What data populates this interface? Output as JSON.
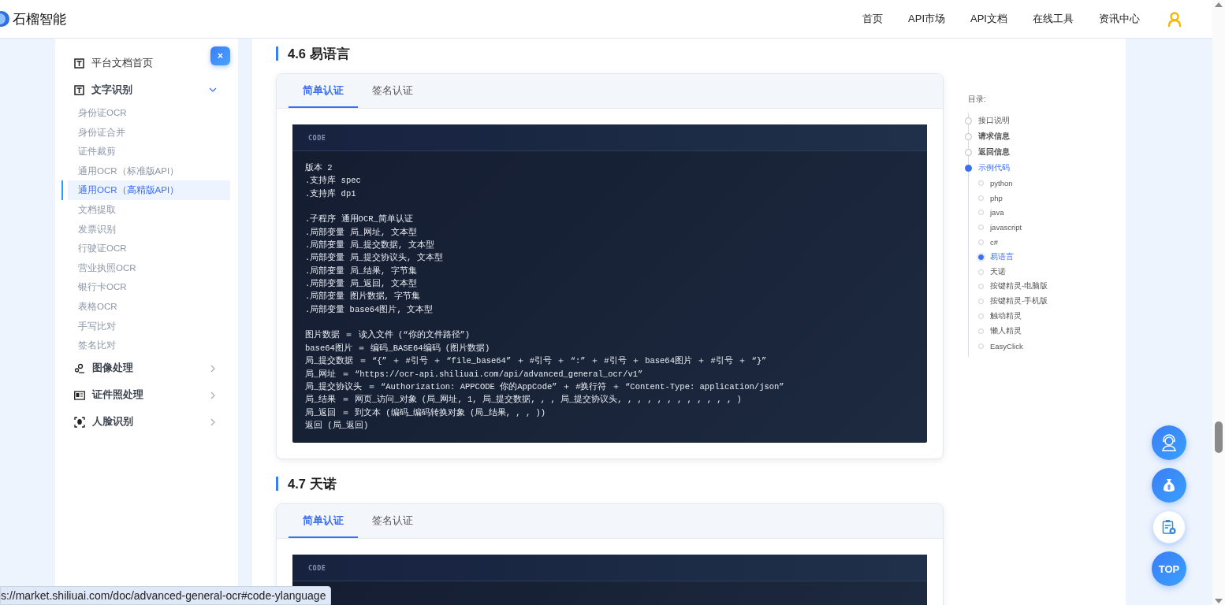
{
  "header": {
    "brand": "石榴智能",
    "nav": [
      {
        "label": "首页"
      },
      {
        "label": "API市场"
      },
      {
        "label": "API文档"
      },
      {
        "label": "在线工具"
      },
      {
        "label": "资讯中心"
      }
    ]
  },
  "sidebar": {
    "close": "×",
    "items": [
      {
        "label": "平台文档首页",
        "kind": "text"
      },
      {
        "label": "文字识别",
        "kind": "text",
        "expanded": true,
        "children": [
          {
            "label": "身份证OCR",
            "selected": false
          },
          {
            "label": "身份证合并",
            "selected": false
          },
          {
            "label": "证件裁剪",
            "selected": false
          },
          {
            "label": "通用OCR（标准版API）",
            "selected": false
          },
          {
            "label": "通用OCR（高精版API）",
            "selected": true
          },
          {
            "label": "文档提取",
            "selected": false
          },
          {
            "label": "发票识别",
            "selected": false
          },
          {
            "label": "行驶证OCR",
            "selected": false
          },
          {
            "label": "营业执照OCR",
            "selected": false
          },
          {
            "label": "银行卡OCR",
            "selected": false
          },
          {
            "label": "表格OCR",
            "selected": false
          },
          {
            "label": "手写比对",
            "selected": false
          },
          {
            "label": "签名比对",
            "selected": false
          }
        ]
      },
      {
        "label": "图像处理",
        "kind": "image",
        "expanded": false
      },
      {
        "label": "证件照处理",
        "kind": "idphoto",
        "expanded": false
      },
      {
        "label": "人脸识别",
        "kind": "face",
        "expanded": false
      }
    ]
  },
  "sections": [
    {
      "title": "4.6 易语言",
      "tabs": [
        {
          "label": "简单认证",
          "selected": true
        },
        {
          "label": "签名认证",
          "selected": false
        }
      ],
      "code_label": "CODE",
      "code": [
        [
          "版本 2",
          ".支持库 spec",
          ".支持库 dp1"
        ],
        [
          ".子程序 通用OCR_简单认证",
          ".局部变量 局_网址, 文本型",
          ".局部变量 局_提交数据, 文本型",
          ".局部变量 局_提交协议头, 文本型",
          ".局部变量 局_结果, 字节集",
          ".局部变量 局_返回, 文本型",
          ".局部变量 图片数据, 字节集",
          ".局部变量 base64图片, 文本型"
        ],
        [
          "图片数据 ＝ 读入文件 (“你的文件路径”)",
          "base64图片 ＝ 编码_BASE64编码 (图片数据)",
          "局_提交数据 ＝ “{” ＋ #引号 ＋ “file_base64” ＋ #引号 ＋ “:” ＋ #引号 ＋ base64图片 ＋ #引号 ＋ “}”",
          "局_网址 ＝ “https://ocr-api.shiliuai.com/api/advanced_general_ocr/v1”",
          "局_提交协议头 ＝ “Authorization: APPCODE 你的AppCode” ＋ #换行符 ＋ “Content-Type: application/json”",
          "局_结果 ＝ 网页_访问_对象 (局_网址, 1, 局_提交数据, , , 局_提交协议头, , , , , , , , , , , , )",
          "局_返回 ＝ 到文本 (编码_编码转换对象 (局_结果, , , ))",
          "返回 (局_返回)"
        ]
      ]
    },
    {
      "title": "4.7 天诺",
      "tabs": [
        {
          "label": "简单认证",
          "selected": true
        },
        {
          "label": "签名认证",
          "selected": false
        }
      ],
      "code_label": "CODE"
    }
  ],
  "toc": {
    "title": "目录:",
    "items": [
      {
        "label": "接口说明",
        "selected": false
      },
      {
        "label": "请求信息",
        "selected": false
      },
      {
        "label": "返回信息",
        "selected": false
      },
      {
        "label": "示例代码",
        "selected": true,
        "children": [
          {
            "label": "python",
            "selected": false
          },
          {
            "label": "php",
            "selected": false
          },
          {
            "label": "java",
            "selected": false
          },
          {
            "label": "javascript",
            "selected": false
          },
          {
            "label": "c#",
            "selected": false
          },
          {
            "label": "易语言",
            "selected": true
          },
          {
            "label": "天诺",
            "selected": false
          },
          {
            "label": "按键精灵-电脑版",
            "selected": false
          },
          {
            "label": "按键精灵-手机版",
            "selected": false
          },
          {
            "label": "触动精灵",
            "selected": false
          },
          {
            "label": "懒人精灵",
            "selected": false
          },
          {
            "label": "EasyClick",
            "selected": false
          }
        ]
      }
    ]
  },
  "float_buttons": [
    {
      "kind": "support"
    },
    {
      "kind": "money"
    },
    {
      "kind": "clipboard"
    },
    {
      "kind": "top",
      "label": "TOP"
    }
  ],
  "status_bar": "s://market.shiliuai.com/doc/advanced-general-ocr#code-ylanguage"
}
